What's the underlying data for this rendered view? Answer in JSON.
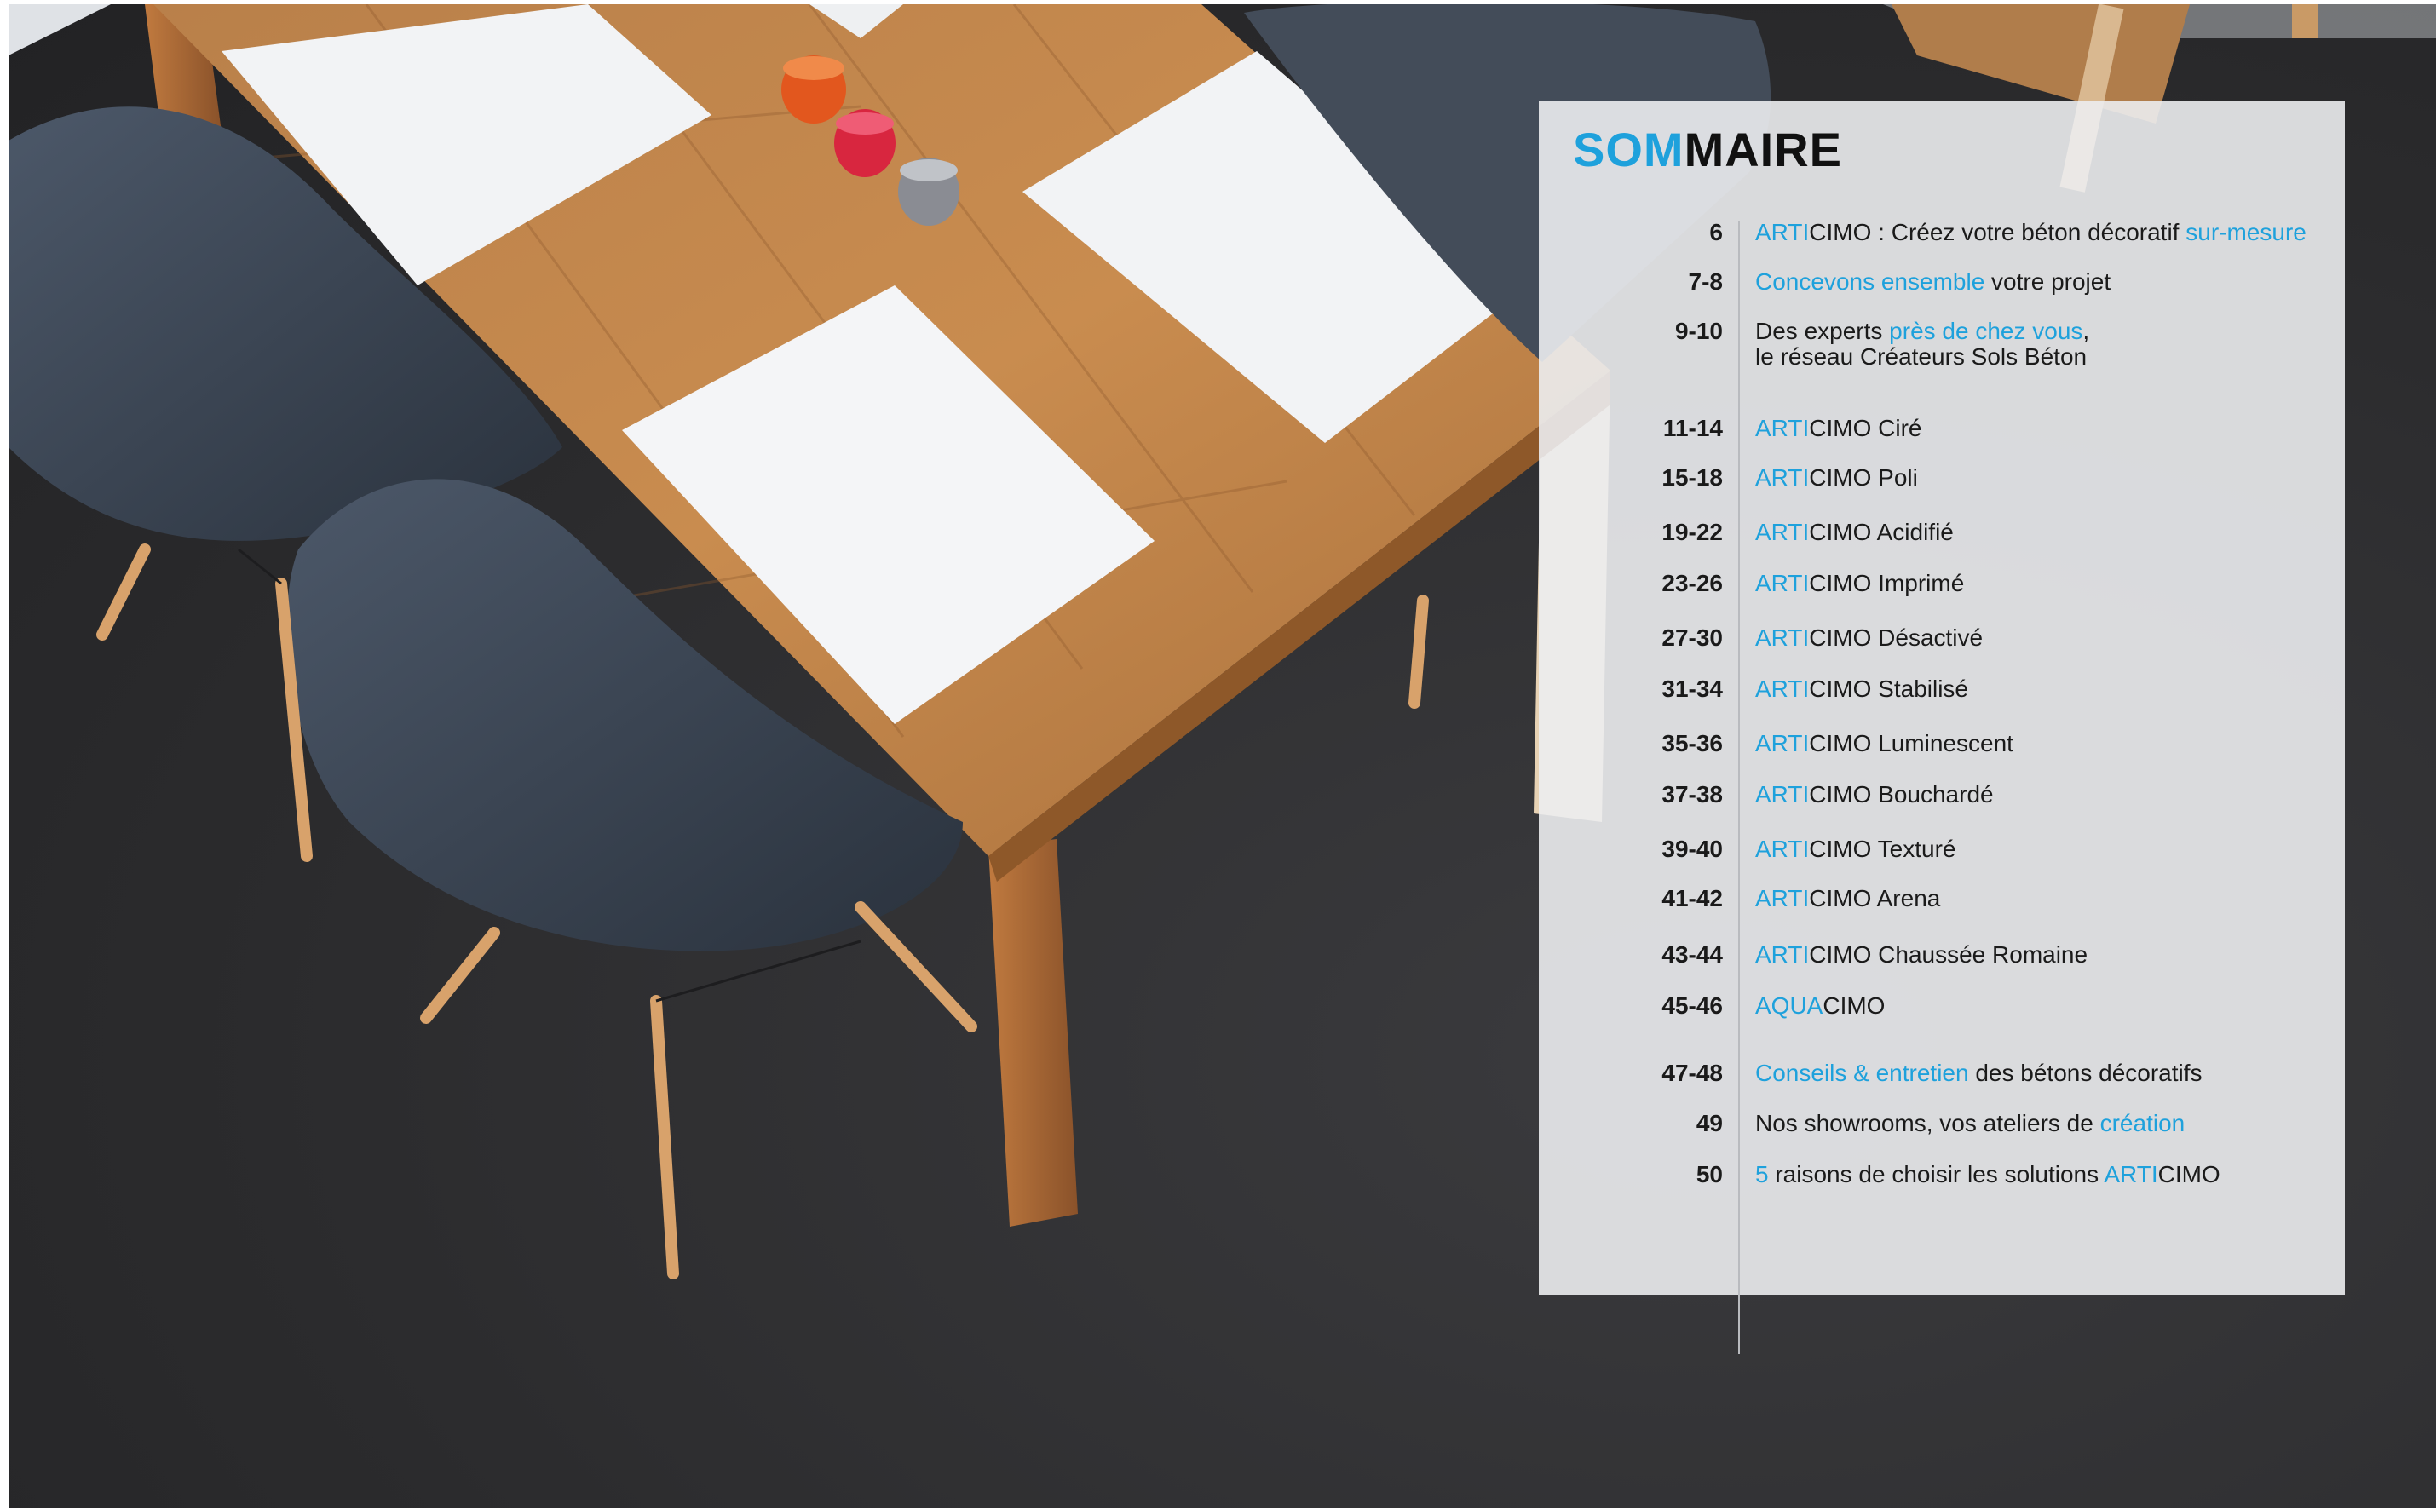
{
  "colors": {
    "accent": "#1ea1dc",
    "text": "#1a1a1a",
    "panel": "#ecedf0"
  },
  "photo": {
    "description_icon": "dining-table-photo-icon"
  },
  "sommaire": {
    "title_accent": "SOM",
    "title_rest": "MAIRE",
    "entries": [
      {
        "page": "6",
        "parts": [
          {
            "t": "ARTI",
            "b": true
          },
          {
            "t": "CIMO : Créez votre béton décoratif ",
            "b": false
          },
          {
            "t": "sur-mesure",
            "b": true
          }
        ]
      },
      {
        "page": "7-8",
        "parts": [
          {
            "t": "Concevons ensemble",
            "b": true
          },
          {
            "t": " votre projet",
            "b": false
          }
        ]
      },
      {
        "page": "9-10",
        "parts": [
          {
            "t": "Des experts ",
            "b": false
          },
          {
            "t": "près de chez vous",
            "b": true
          },
          {
            "t": ",",
            "b": false
          }
        ],
        "line2": "le réseau Créateurs Sols Béton"
      },
      {
        "page": "11-14",
        "parts": [
          {
            "t": "ARTI",
            "b": true
          },
          {
            "t": "CIMO Ciré",
            "b": false
          }
        ]
      },
      {
        "page": "15-18",
        "parts": [
          {
            "t": "ARTI",
            "b": true
          },
          {
            "t": "CIMO Poli",
            "b": false
          }
        ]
      },
      {
        "page": "19-22",
        "parts": [
          {
            "t": "ARTI",
            "b": true
          },
          {
            "t": "CIMO Acidifié",
            "b": false
          }
        ]
      },
      {
        "page": "23-26",
        "parts": [
          {
            "t": "ARTI",
            "b": true
          },
          {
            "t": "CIMO Imprimé",
            "b": false
          }
        ]
      },
      {
        "page": "27-30",
        "parts": [
          {
            "t": "ARTI",
            "b": true
          },
          {
            "t": "CIMO Désactivé",
            "b": false
          }
        ]
      },
      {
        "page": "31-34",
        "parts": [
          {
            "t": "ARTI",
            "b": true
          },
          {
            "t": "CIMO Stabilisé",
            "b": false
          }
        ]
      },
      {
        "page": "35-36",
        "parts": [
          {
            "t": "ARTI",
            "b": true
          },
          {
            "t": "CIMO Luminescent",
            "b": false
          }
        ]
      },
      {
        "page": "37-38",
        "parts": [
          {
            "t": "ARTI",
            "b": true
          },
          {
            "t": "CIMO Bouchardé",
            "b": false
          }
        ]
      },
      {
        "page": "39-40",
        "parts": [
          {
            "t": "ARTI",
            "b": true
          },
          {
            "t": "CIMO Texturé",
            "b": false
          }
        ]
      },
      {
        "page": "41-42",
        "parts": [
          {
            "t": "ARTI",
            "b": true
          },
          {
            "t": "CIMO Arena",
            "b": false
          }
        ]
      },
      {
        "page": "43-44",
        "parts": [
          {
            "t": "ARTI",
            "b": true
          },
          {
            "t": "CIMO Chaussée Romaine",
            "b": false
          }
        ]
      },
      {
        "page": "45-46",
        "parts": [
          {
            "t": "AQUA",
            "b": true
          },
          {
            "t": "CIMO",
            "b": false
          }
        ]
      },
      {
        "page": "47-48",
        "parts": [
          {
            "t": "Conseils & entretien",
            "b": true
          },
          {
            "t": " des bétons décoratifs",
            "b": false
          }
        ]
      },
      {
        "page": "49",
        "parts": [
          {
            "t": "Nos showrooms, vos ateliers de ",
            "b": false
          },
          {
            "t": "création",
            "b": true
          }
        ]
      },
      {
        "page": "50",
        "parts": [
          {
            "t": "5",
            "b": true
          },
          {
            "t": " raisons de choisir les solutions ",
            "b": false
          },
          {
            "t": "ARTI",
            "b": true
          },
          {
            "t": "CIMO",
            "b": false
          }
        ]
      }
    ]
  }
}
